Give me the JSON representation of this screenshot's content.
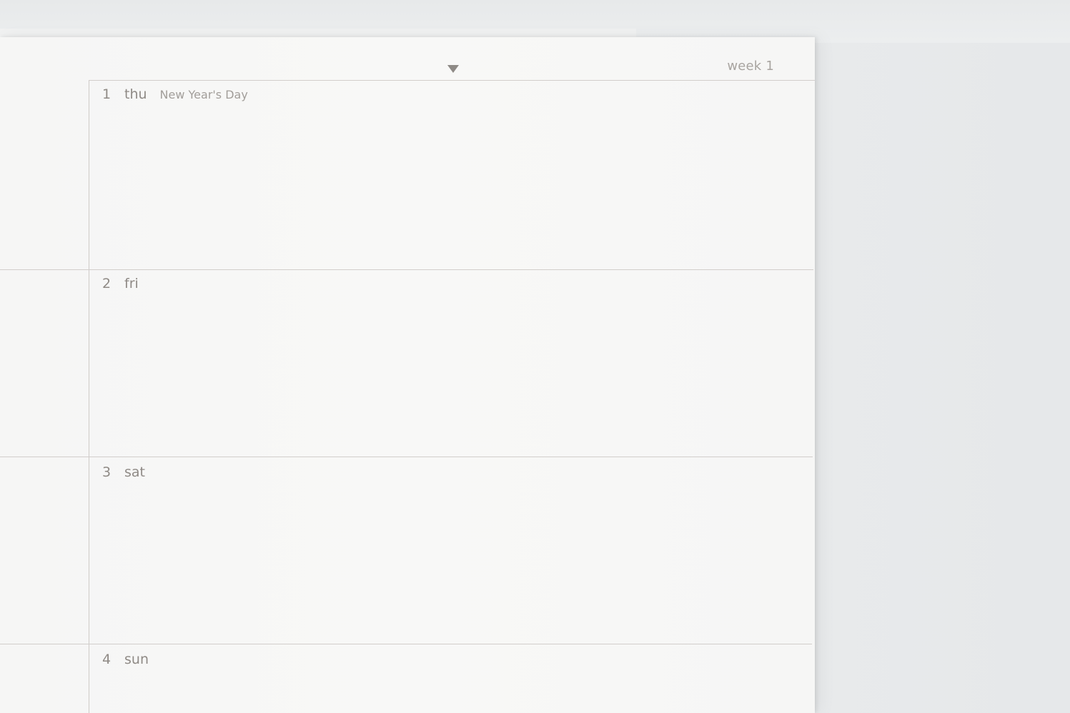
{
  "planner": {
    "week_label": "week 1",
    "days": [
      {
        "number": "1",
        "name": "thu",
        "holiday": "New Year's Day"
      },
      {
        "number": "2",
        "name": "fri",
        "holiday": ""
      },
      {
        "number": "3",
        "name": "sat",
        "holiday": ""
      },
      {
        "number": "4",
        "name": "sun",
        "holiday": ""
      }
    ]
  },
  "colors": {
    "paper": "#f7f7f6",
    "ink": "#8f8a86",
    "rule": "#d2cecb",
    "marker": "#8e8a86"
  }
}
